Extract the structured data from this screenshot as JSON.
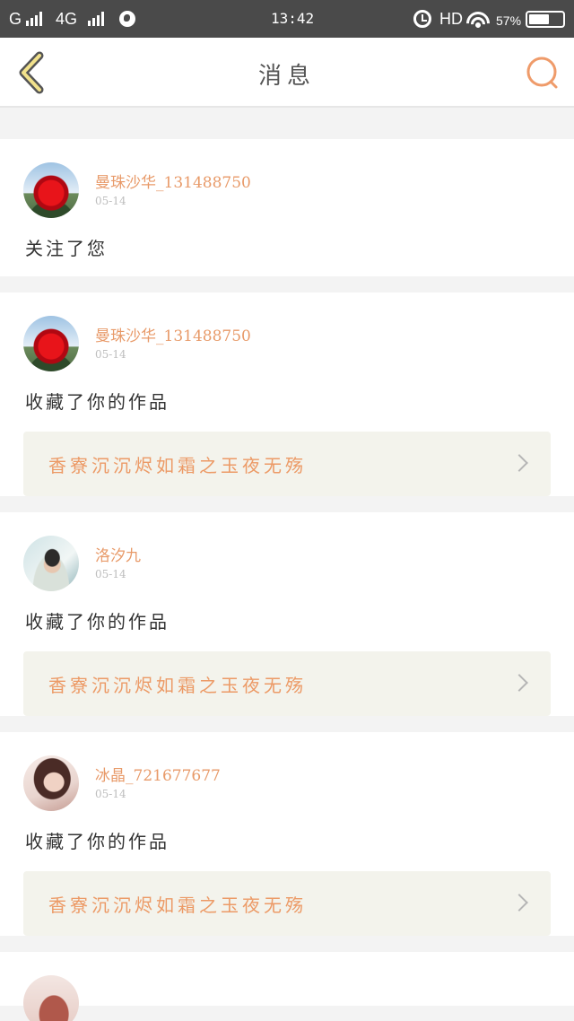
{
  "status_bar": {
    "carrier": "G",
    "network": "4G",
    "time": "13:42",
    "hd": "HD",
    "battery": "57%"
  },
  "nav": {
    "title": "消息"
  },
  "messages": [
    {
      "username": "曼珠沙华_131488750",
      "date": "05-14",
      "action": "关注了您"
    },
    {
      "username": "曼珠沙华_131488750",
      "date": "05-14",
      "action": "收藏了你的作品",
      "work_title": "香寮沉沉烬如霜之玉夜无殇"
    },
    {
      "username": "洛汐九",
      "date": "05-14",
      "action": "收藏了你的作品",
      "work_title": "香寮沉沉烬如霜之玉夜无殇"
    },
    {
      "username": "冰晶_721677677",
      "date": "05-14",
      "action": "收藏了你的作品",
      "work_title": "香寮沉沉烬如霜之玉夜无殇"
    }
  ],
  "colors": {
    "accent": "#e89a69",
    "work_bg": "#f3f3ec",
    "status_bar": "#4a4a4a"
  }
}
